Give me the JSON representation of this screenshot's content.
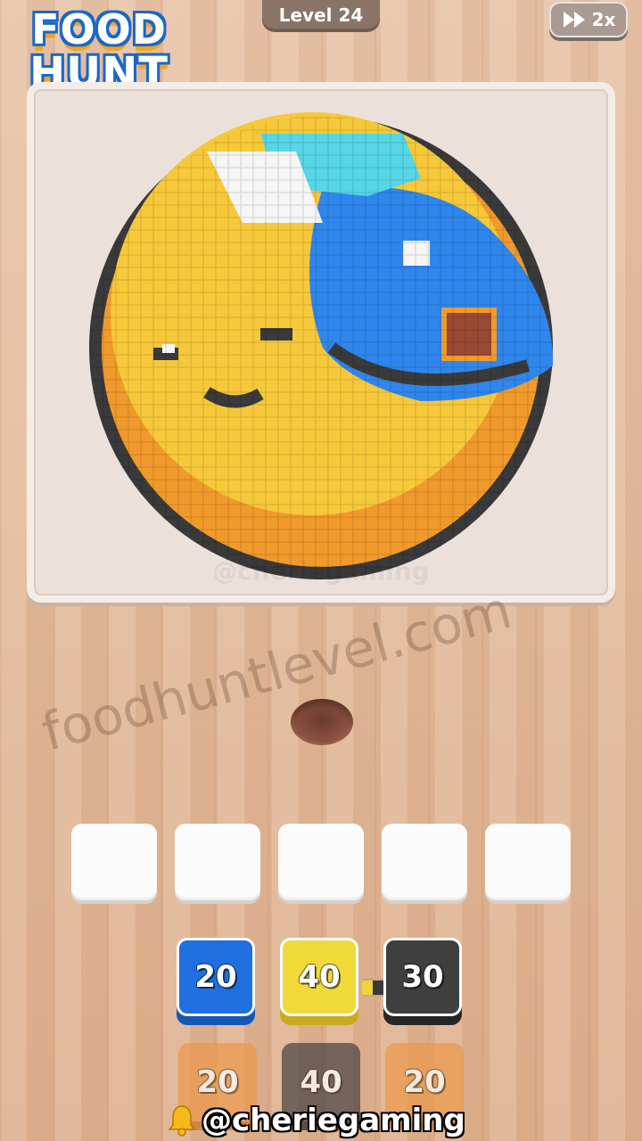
{
  "logo": {
    "line1": "FOOD",
    "line2": "HUNT"
  },
  "header": {
    "level_label": "Level 24",
    "speed_label": "2x"
  },
  "board": {
    "watermark": "@cheriegaming"
  },
  "site_watermark": "foodhuntlevel.com",
  "slots": {
    "count": 5,
    "filled": 0
  },
  "tiles": {
    "front_row": [
      {
        "value": "20",
        "color": "#1f6fe0",
        "dark": "#1557b8"
      },
      {
        "value": "40",
        "color": "#f2d93a",
        "dark": "#caa91d"
      },
      {
        "value": "30",
        "color": "#3f3f3f",
        "dark": "#262626"
      }
    ],
    "back_row": [
      {
        "value": "20",
        "color": "#ec9a4c",
        "dark": "#c8772f"
      },
      {
        "value": "40",
        "color": "#4a4444",
        "dark": "#2f2b2b"
      },
      {
        "value": "20",
        "color": "#ec9a4c",
        "dark": "#c8772f"
      }
    ]
  },
  "creator": {
    "handle": "@cheriegaming",
    "icon": "bell-icon"
  },
  "palette": {
    "yellow": "#f7c93a",
    "orange": "#f19a2c",
    "blue": "#2f86ec",
    "cyan": "#56d6e6",
    "white": "#f6f6f6",
    "outline": "#3a3a3a",
    "brown": "#9a4a34"
  }
}
